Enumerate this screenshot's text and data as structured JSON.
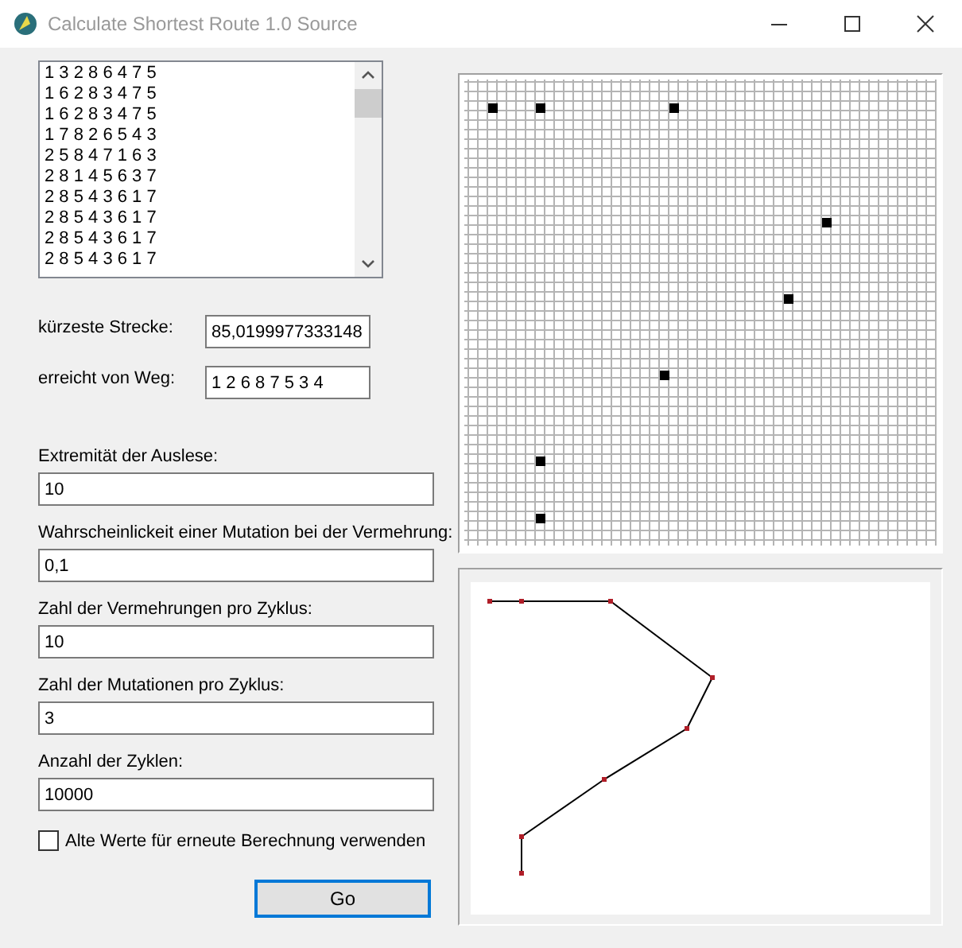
{
  "window": {
    "title": "Calculate Shortest Route 1.0 Source"
  },
  "population_list": {
    "items": [
      "1 3 2 8 6 4 7 5",
      "1 6 2 8 3 4 7 5",
      "1 6 2 8 3 4 7 5",
      "1 7 8 2 6 5 4 3",
      "2 5 8 4 7 1 6 3",
      "2 8 1 4 5 6 3 7",
      "2 8 5 4 3 6 1 7",
      "2 8 5 4 3 6 1 7",
      "2 8 5 4 3 6 1 7",
      "2 8 5 4 3 6 1 7"
    ]
  },
  "results": [
    {
      "label": "kürzeste Strecke:",
      "value": "85,0199977333148"
    },
    {
      "label": "erreicht von Weg:",
      "value": "1 2 6 8 7 5 3 4"
    }
  ],
  "parameters": [
    {
      "label": "Extremität der Auslese:",
      "value": "10"
    },
    {
      "label": "Wahrscheinlickeit einer Mutation bei der Vermehrung:",
      "value": "0,1"
    },
    {
      "label": "Zahl der Vermehrungen pro Zyklus:",
      "value": "10"
    },
    {
      "label": "Zahl der Mutationen pro Zyklus:",
      "value": "3"
    },
    {
      "label": "Anzahl der Zyklen:",
      "value": "10000"
    }
  ],
  "reuse_checkbox": {
    "label": "Alte Werte für erneute Berechnung verwenden",
    "checked": false
  },
  "go_button": {
    "label": "Go"
  }
}
